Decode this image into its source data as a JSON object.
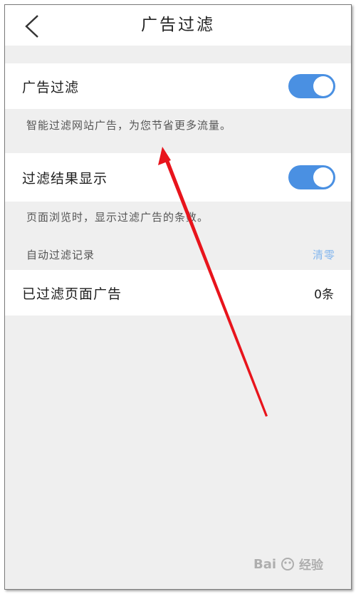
{
  "header": {
    "title": "广告过滤"
  },
  "ad_filter": {
    "label": "广告过滤",
    "enabled": true,
    "description": "智能过滤网站广告，为您节省更多流量。"
  },
  "result_display": {
    "label": "过滤结果显示",
    "enabled": true,
    "description": "页面浏览时，显示过滤广告的条数。"
  },
  "auto_record": {
    "label": "自动过滤记录",
    "clear_label": "清零"
  },
  "filtered_pages": {
    "label": "已过滤页面广告",
    "count": "0条"
  },
  "watermark": {
    "text": "经验"
  },
  "colors": {
    "toggle_on": "#4a90e2",
    "link": "#86b7ee",
    "background": "#efefef",
    "arrow": "#e8141c"
  }
}
